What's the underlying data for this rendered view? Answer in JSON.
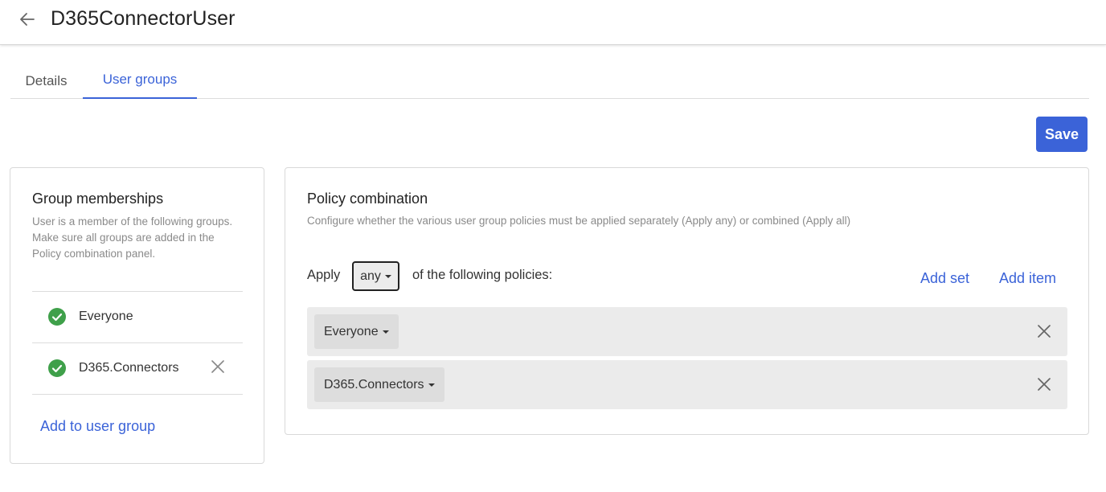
{
  "header": {
    "title": "D365ConnectorUser",
    "back_icon": "arrow-left-icon"
  },
  "tabs": [
    {
      "label": "Details",
      "active": false
    },
    {
      "label": "User groups",
      "active": true
    }
  ],
  "toolbar": {
    "save_label": "Save"
  },
  "group_memberships": {
    "title": "Group memberships",
    "description": "User is a member of the following groups. Make sure all groups are added in the Policy combination panel.",
    "members": [
      {
        "label": "Everyone",
        "status_icon": "check-circle-icon",
        "removable": false
      },
      {
        "label": "D365.Connectors",
        "status_icon": "check-circle-icon",
        "removable": true
      }
    ],
    "add_link": "Add to user group"
  },
  "policy_combination": {
    "title": "Policy combination",
    "description": "Configure whether the various user group policies must be applied separately (Apply any) or combined (Apply all)",
    "apply_label": "Apply",
    "apply_value": "any",
    "following_label": "of the following policies:",
    "add_set_label": "Add set",
    "add_item_label": "Add item",
    "policies": [
      {
        "label": "Everyone"
      },
      {
        "label": "D365.Connectors"
      }
    ]
  },
  "colors": {
    "accent": "#3b63d8",
    "success": "#3fa04a",
    "row_background": "#ebebeb"
  }
}
